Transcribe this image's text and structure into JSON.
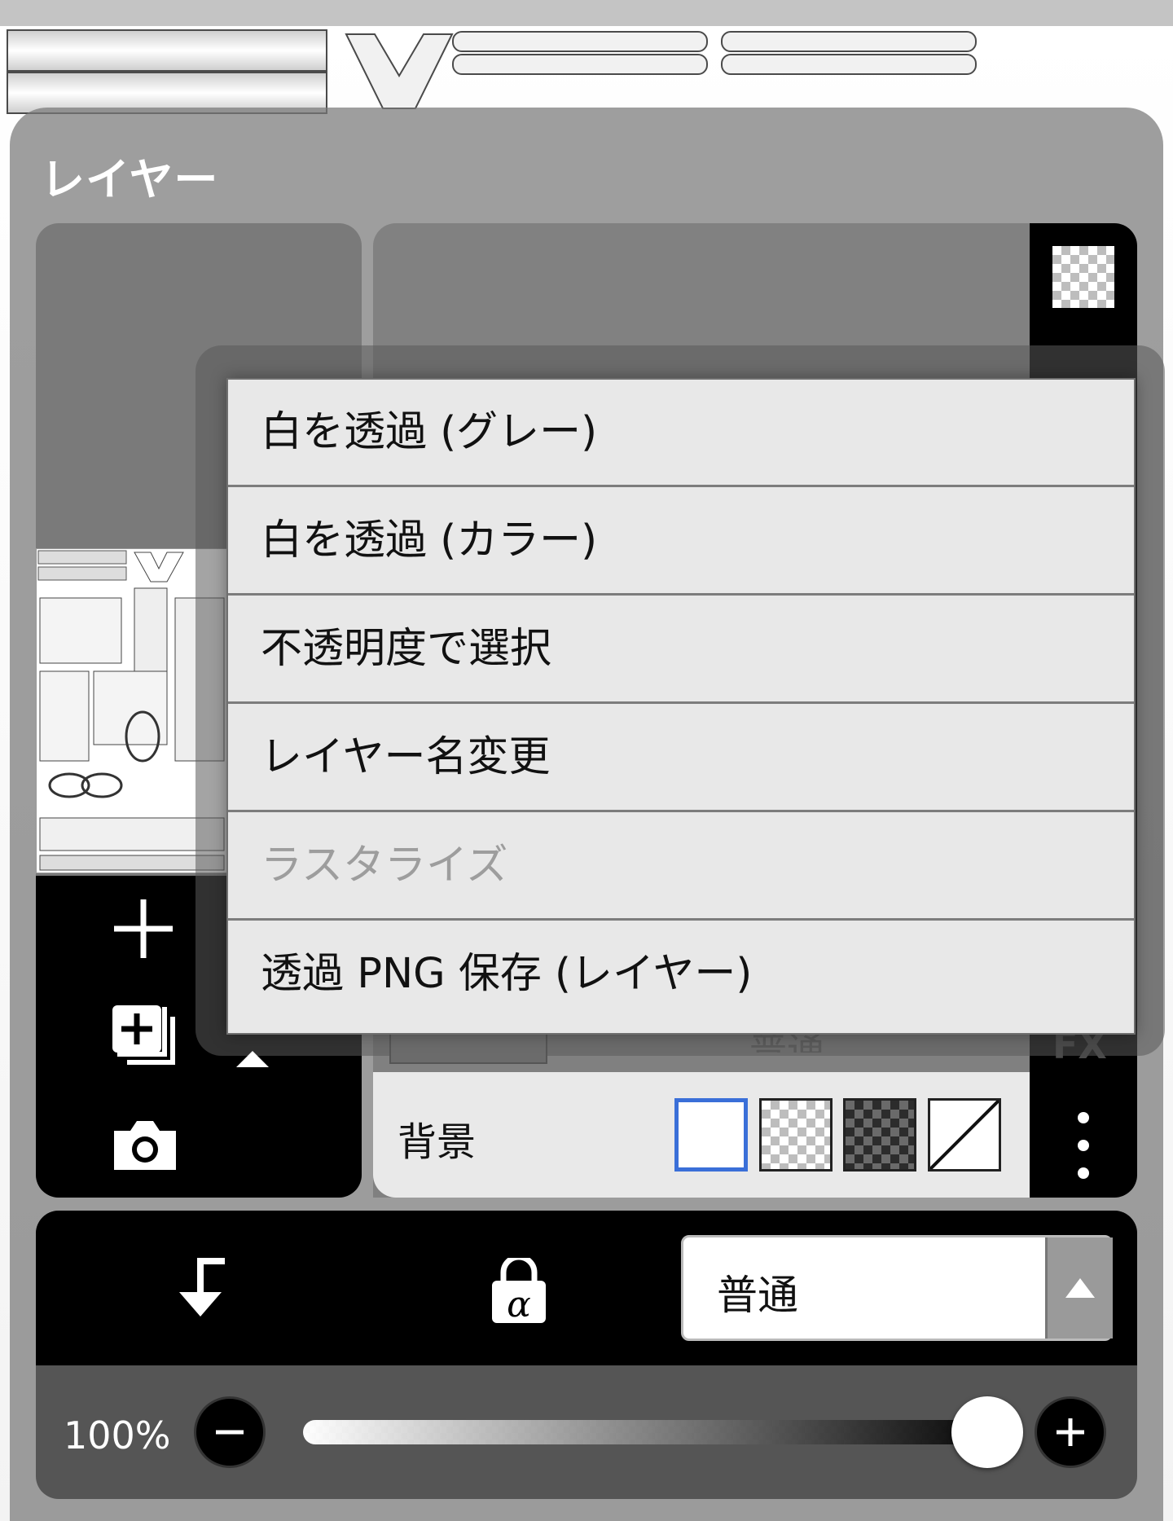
{
  "panel": {
    "title": "レイヤー"
  },
  "menu": {
    "items": [
      {
        "label": "白を透過 (グレー)",
        "enabled": true
      },
      {
        "label": "白を透過 (カラー)",
        "enabled": true
      },
      {
        "label": "不透明度で選択",
        "enabled": true
      },
      {
        "label": "レイヤー名変更",
        "enabled": true
      },
      {
        "label": "ラスタライズ",
        "enabled": false
      },
      {
        "label": "透過 PNG 保存 (レイヤー)",
        "enabled": true
      }
    ]
  },
  "layer_row": {
    "blend_mode_partial": "普通",
    "fx_label": "FX"
  },
  "background_row": {
    "label": "背景",
    "options": [
      "white",
      "checker-light",
      "checker-dark",
      "none"
    ],
    "selected": "white"
  },
  "left_tools": {
    "icons": [
      "add-layer-icon",
      "duplicate-layer-icon",
      "camera-icon"
    ]
  },
  "right_tools": {
    "icons": [
      "transparency-icon",
      "more-vertical-icon"
    ]
  },
  "bottom": {
    "icons": [
      "clip-arrow-icon",
      "alpha-lock-icon"
    ],
    "blend_mode": "普通",
    "opacity_label": "100%",
    "opacity_value": 1.0
  },
  "colors": {
    "selected_swatch_border": "#3a6fd8",
    "menu_bg": "#e8e8e8",
    "panel_black": "#000000"
  }
}
